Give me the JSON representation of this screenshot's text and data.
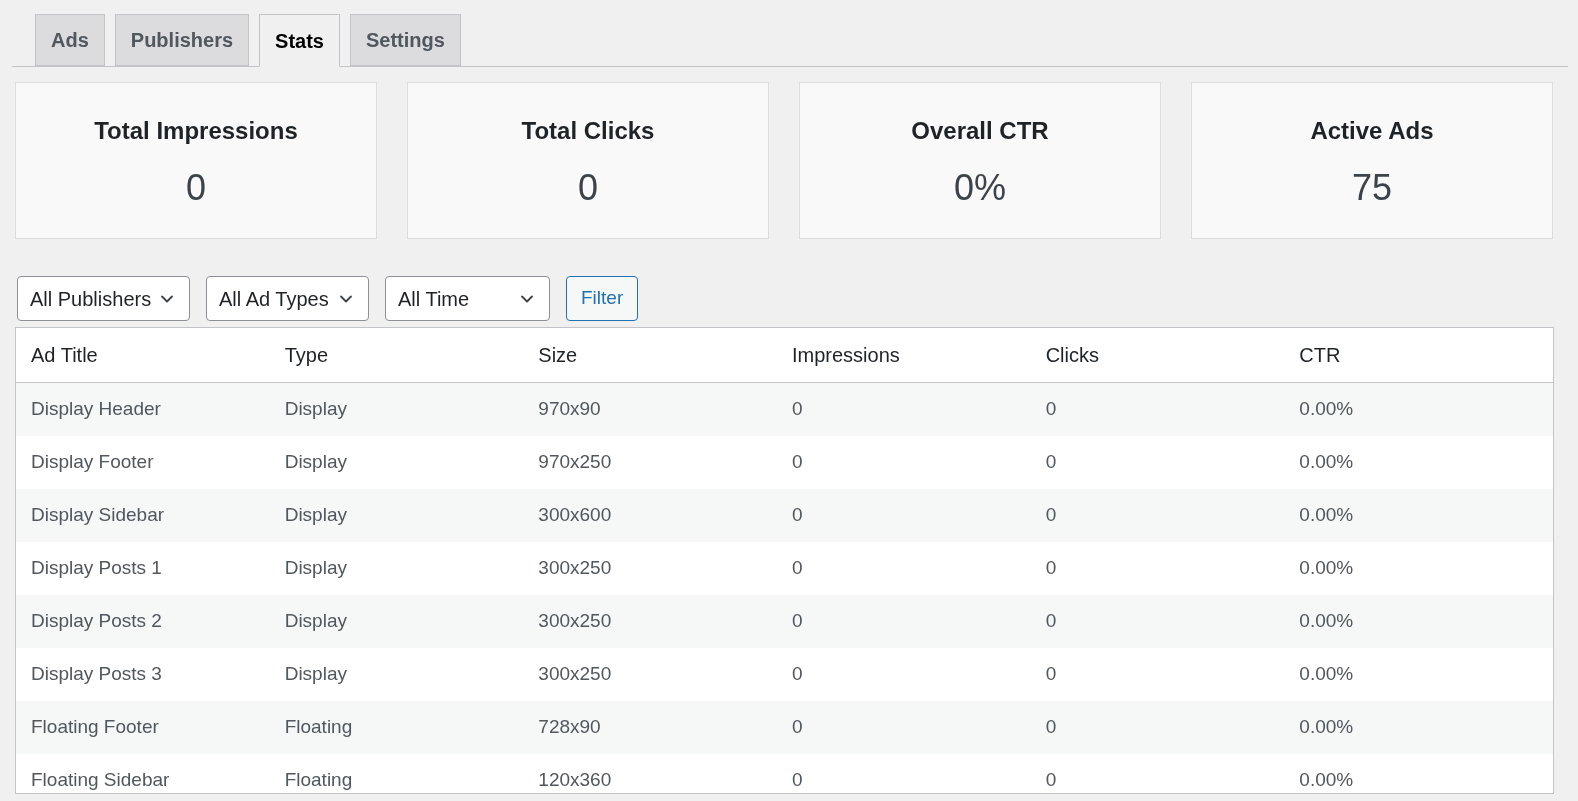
{
  "tabs": [
    {
      "label": "Ads",
      "selected": false
    },
    {
      "label": "Publishers",
      "selected": false
    },
    {
      "label": "Stats",
      "selected": true
    },
    {
      "label": "Settings",
      "selected": false
    }
  ],
  "stat_cards": [
    {
      "title": "Total Impressions",
      "value": "0"
    },
    {
      "title": "Total Clicks",
      "value": "0"
    },
    {
      "title": "Overall CTR",
      "value": "0%"
    },
    {
      "title": "Active Ads",
      "value": "75"
    }
  ],
  "filters": {
    "dropdowns": [
      "All Publishers",
      "All Ad Types",
      "All Time"
    ],
    "button": "Filter"
  },
  "table": {
    "columns": [
      "Ad Title",
      "Type",
      "Size",
      "Impressions",
      "Clicks",
      "CTR"
    ],
    "rows": [
      [
        "Display Header",
        "Display",
        "970x90",
        "0",
        "0",
        "0.00%"
      ],
      [
        "Display Footer",
        "Display",
        "970x250",
        "0",
        "0",
        "0.00%"
      ],
      [
        "Display Sidebar",
        "Display",
        "300x600",
        "0",
        "0",
        "0.00%"
      ],
      [
        "Display Posts 1",
        "Display",
        "300x250",
        "0",
        "0",
        "0.00%"
      ],
      [
        "Display Posts 2",
        "Display",
        "300x250",
        "0",
        "0",
        "0.00%"
      ],
      [
        "Display Posts 3",
        "Display",
        "300x250",
        "0",
        "0",
        "0.00%"
      ],
      [
        "Floating Footer",
        "Floating",
        "728x90",
        "0",
        "0",
        "0.00%"
      ],
      [
        "Floating Sidebar",
        "Floating",
        "120x360",
        "0",
        "0",
        "0.00%"
      ]
    ]
  }
}
